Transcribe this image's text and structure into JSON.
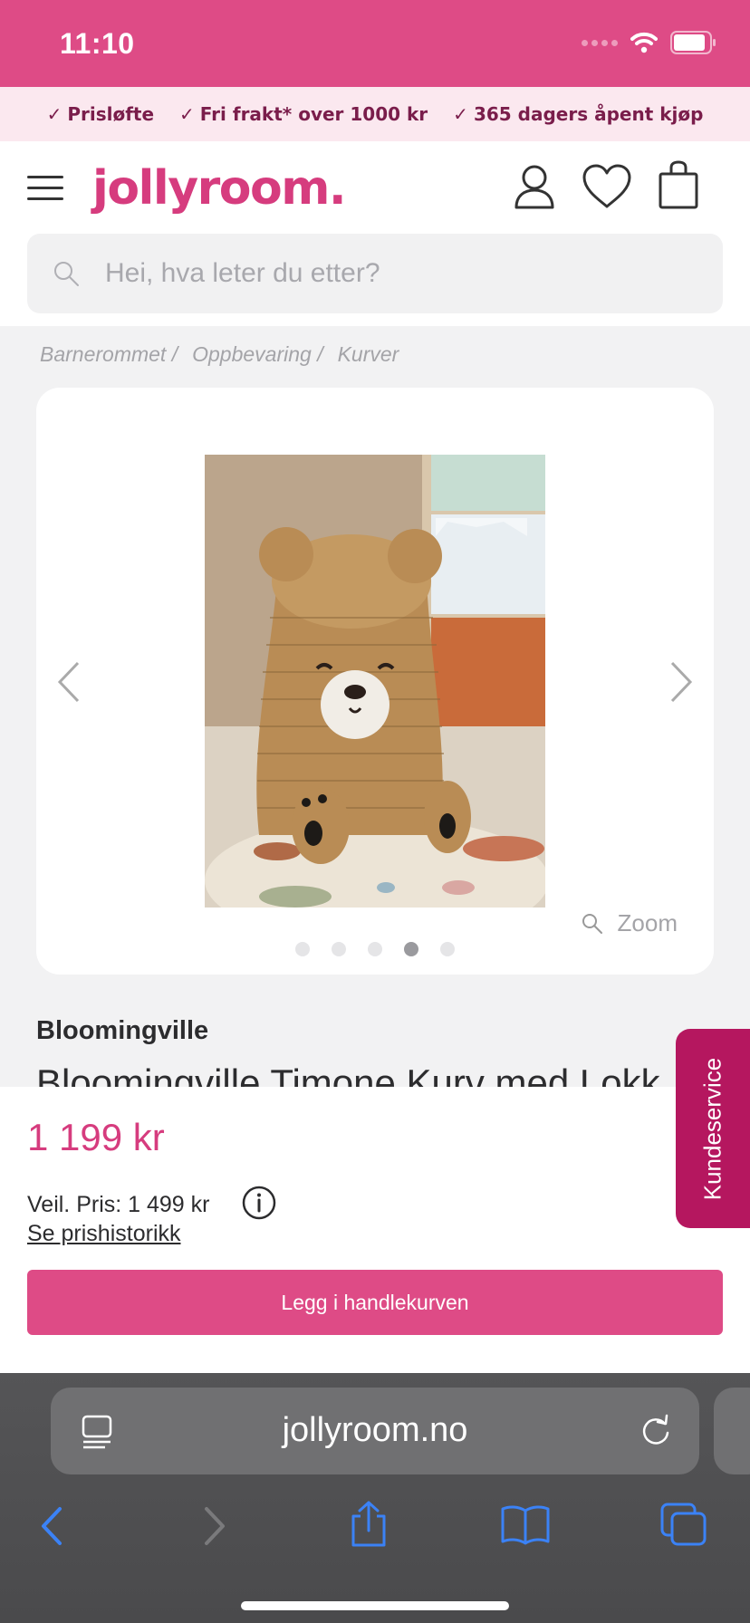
{
  "status_bar": {
    "time": "11:10"
  },
  "usp": [
    {
      "label": "Prisløfte"
    },
    {
      "label": "Fri frakt* over 1000 kr"
    },
    {
      "label": "365 dagers åpent kjøp"
    }
  ],
  "header": {
    "logo": "jollyroom.",
    "search_placeholder": "Hei, hva leter du etter?"
  },
  "breadcrumb": [
    "Barnerommet",
    "Oppbevaring",
    "Kurver"
  ],
  "gallery": {
    "zoom_label": "Zoom",
    "image_count": 5,
    "active_index": 3
  },
  "product": {
    "brand": "Bloomingville",
    "title": "Bloomingville Timone Kurv med Lokk",
    "price": "1 199 kr",
    "recommended_price": "Veil. Pris: 1 499 kr",
    "price_history_link": "Se prishistorikk",
    "add_to_cart": "Legg i handlekurven"
  },
  "customer_service_tab": "Kundeservice",
  "browser": {
    "url": "jollyroom.no"
  },
  "colors": {
    "brand_pink": "#de4b86",
    "cs_tab": "#b5175f",
    "ios_blue": "#3b82f6"
  }
}
